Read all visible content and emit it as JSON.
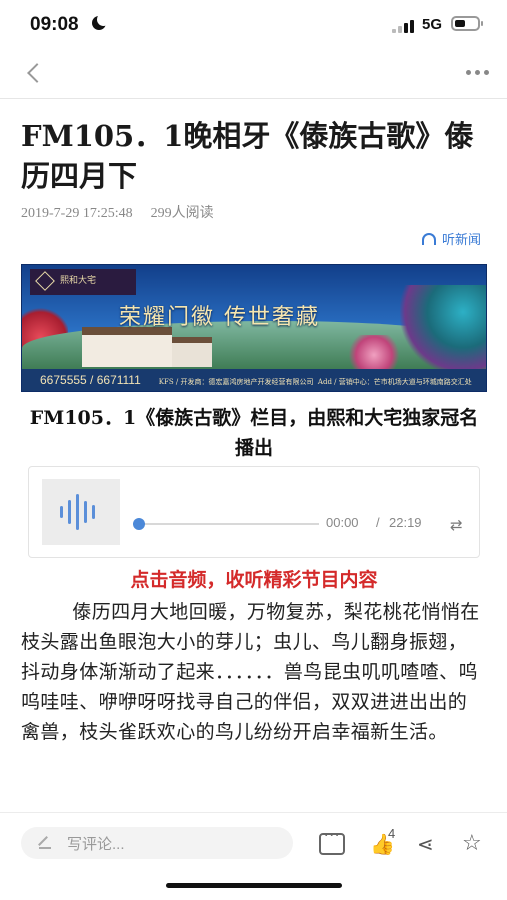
{
  "status_bar": {
    "time": "09:08",
    "network": "5G"
  },
  "nav": {
    "back_icon": "chevron-left-icon",
    "more_icon": "more-dots-icon"
  },
  "article": {
    "title": "FM105．1晚相牙《傣族古歌》傣历四月下",
    "date": "2019-7-29 17:25:48",
    "reads": "299人阅读",
    "listen_label": "听新闻",
    "sponsor_text": "FM105．1《傣族古歌》栏目，由熙和大宅独家冠名播出",
    "cta": "点击音频，收听精彩节目内容",
    "paragraphs": [
      "傣历四月大地回暖，万物复苏，梨花桃花悄悄在枝头露出鱼眼泡大小的芽儿；虫儿、鸟儿翻身振翅，抖动身体渐渐动了起来．．．．．．兽鸟昆虫叽叽喳喳、呜呜哇哇、咿咿呀呀找寻自己的伴侣，双双进进出出的禽兽，枝头雀跃欢心的鸟儿纷纷开启幸福新生活。"
    ]
  },
  "banner": {
    "logo_text": "熙和大宅",
    "slogan": "荣耀门徽 传世奢藏",
    "phone": "6675555 / 6671111",
    "footer_left": "KFS / 开发商：德宏嘉鸿房地产开发经营有限公司",
    "footer_right": "Add / 营销中心：芒市机场大道与环城南路交汇处"
  },
  "audio_player": {
    "current_time": "00:00",
    "separator": "/",
    "total_time": "22:19",
    "progress": 0,
    "loop_icon": "loop-icon"
  },
  "bottom_bar": {
    "comment_placeholder": "写评论...",
    "like_count": "4",
    "icons": [
      "comment-icon",
      "like-icon",
      "share-icon",
      "star-icon"
    ]
  },
  "colors": {
    "accent_blue": "#3a7bd5",
    "cta_red": "#d42a2a",
    "audio_blue": "#4b88d8"
  }
}
